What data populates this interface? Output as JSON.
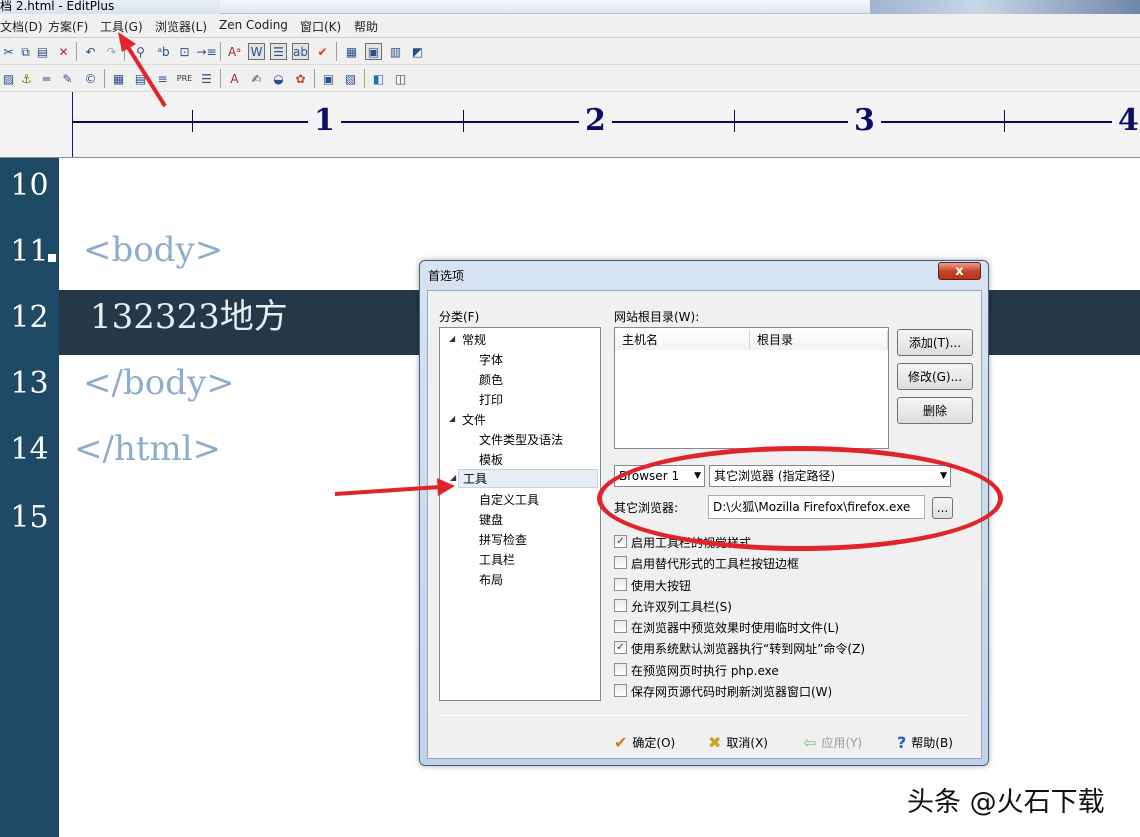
{
  "window": {
    "title": "档 2.html - EditPlus"
  },
  "menu": [
    {
      "label": "文档(D)"
    },
    {
      "label": "方案(F)"
    },
    {
      "label": "工具(G)"
    },
    {
      "label": "浏览器(L)"
    },
    {
      "label": "Zen Coding"
    },
    {
      "label": "窗口(K)"
    },
    {
      "label": "帮助"
    }
  ],
  "ruler": {
    "marks": [
      "1",
      "2",
      "3",
      "4"
    ]
  },
  "editor": {
    "lines": [
      {
        "num": "10",
        "text": ""
      },
      {
        "num": "11",
        "text": "<body>"
      },
      {
        "num": "12",
        "text": "132323地方"
      },
      {
        "num": "13",
        "text": "</body>"
      },
      {
        "num": "14",
        "text": "</html>"
      },
      {
        "num": "15",
        "text": ""
      }
    ]
  },
  "dialog": {
    "title": "首选项",
    "close_label": "x",
    "category_label": "分类(F)",
    "tree": [
      {
        "label": "常规",
        "children": [
          "字体",
          "颜色",
          "打印"
        ]
      },
      {
        "label": "文件",
        "children": [
          "文件类型及语法",
          "模板"
        ]
      },
      {
        "label": "工具",
        "selected": true,
        "children": [
          "自定义工具",
          "键盘",
          "拼写检查",
          "工具栏",
          "布局"
        ]
      }
    ],
    "webroot_label": "网站根目录(W):",
    "columns": [
      "主机名",
      "根目录"
    ],
    "buttons": {
      "add": "添加(T)...",
      "modify": "修改(G)...",
      "delete": "删除"
    },
    "browser_select": "Browser 1",
    "browser_type": "其它浏览器 (指定路径)",
    "other_browser_label": "其它浏览器:",
    "other_browser_path": "D:\\火狐\\Mozilla Firefox\\firefox.exe",
    "browse_button": "...",
    "options": [
      {
        "label": "启用工具栏的视觉样式",
        "checked": true
      },
      {
        "label": "启用替代形式的工具栏按钮边框",
        "checked": false
      },
      {
        "label": "使用大按钮",
        "checked": false
      },
      {
        "label": "允许双列工具栏(S)",
        "checked": false
      },
      {
        "label": "在浏览器中预览效果时使用临时文件(L)",
        "checked": false
      },
      {
        "label": "使用系统默认浏览器执行“转到网址”命令(Z)",
        "checked": true
      },
      {
        "label": "在预览网页时执行 php.exe",
        "checked": false
      },
      {
        "label": "保存网页源代码时刷新浏览器窗口(W)",
        "checked": false
      }
    ],
    "footer": {
      "ok": "确定(O)",
      "cancel": "取消(X)",
      "apply": "应用(Y)",
      "help": "帮助(B)"
    }
  },
  "watermark": "头条 @火石下载",
  "colors": {
    "gutter": "#1f4a66",
    "current_line": "#253848",
    "code_text": "#8eadcc",
    "annotation": "#e0242a"
  }
}
